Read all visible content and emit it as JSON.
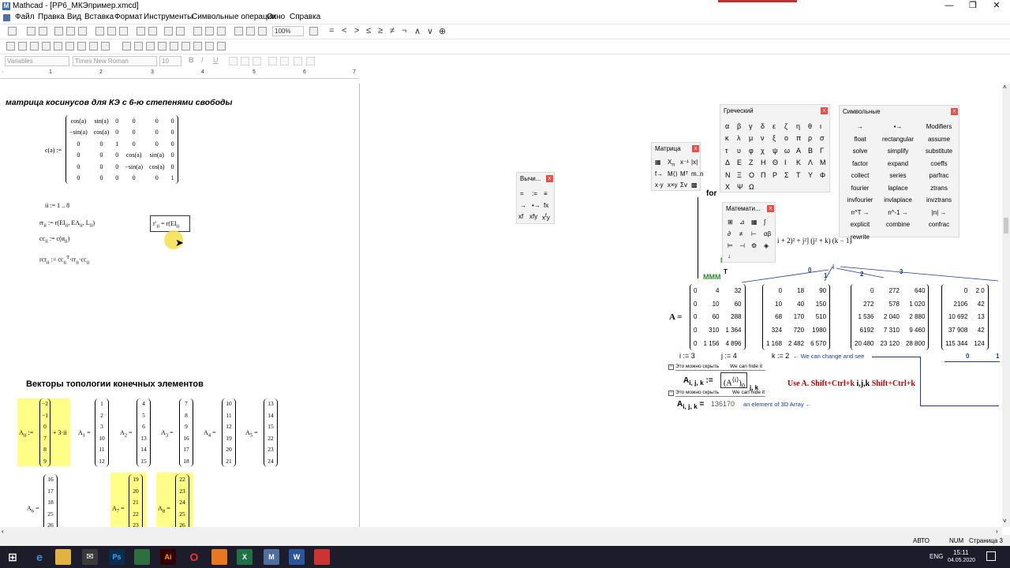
{
  "window": {
    "title": "Mathcad - [PP6_МКЭпример.xmcd]",
    "minimize": "—",
    "restore": "❐",
    "close": "✕"
  },
  "menu": [
    "Файл",
    "Правка",
    "Вид",
    "Вставка",
    "Формат",
    "Инструменты",
    "Символьные операции",
    "Окно",
    "Справка"
  ],
  "toolbar": {
    "zoom": "100%",
    "style": "Variables",
    "font": "Times New Roman",
    "size": "10",
    "bold": "B",
    "italic": "I",
    "underline": "U"
  },
  "ruler": [
    "1",
    "2",
    "3",
    "4",
    "5",
    "6",
    "7"
  ],
  "doc": {
    "heading1": "матрица косинусов для КЭ с 6-ю степенями свободы",
    "c_lhs": "c(a) :=",
    "c_matrix": [
      [
        "cos(a)",
        "sin(a)",
        "0",
        "0",
        "0",
        "0"
      ],
      [
        "−sin(a)",
        "cos(a)",
        "0",
        "0",
        "0",
        "0"
      ],
      [
        "0",
        "0",
        "1",
        "0",
        "0",
        "0"
      ],
      [
        "0",
        "0",
        "0",
        "cos(a)",
        "sin(a)",
        "0"
      ],
      [
        "0",
        "0",
        "0",
        "−sin(a)",
        "cos(a)",
        "0"
      ],
      [
        "0",
        "0",
        "0",
        "0",
        "0",
        "1"
      ]
    ],
    "ii_def": "ii := 1 .. 8",
    "rr_def": "rr<sub>ii</sub> := r(EI<sub>ii</sub>, EA<sub>ii</sub>, L<sub>ii</sub>)",
    "r_box": "r′<sub>ii</sub> = r(EI<sub>ii</sub>",
    "cc_def": "cc<sub>ii</sub> := c(α<sub>ii</sub>)",
    "rcr_def": "rcr<sub>ii</sub> := cc<sub>ii</sub><sup>T</sup>·rr<sub>ii</sub>·cc<sub>ii</sub>",
    "heading2": "Векторы топологии конечных элементов",
    "A_ii_lhs": "A<sub>ii</sub> :=",
    "A_ii_vec": [
      "−2",
      "−1",
      "0",
      "7",
      "8",
      "9"
    ],
    "A_ii_rhs": "+ 3·ii",
    "vectors": [
      {
        "label": "A<sub>1</sub> =",
        "values": [
          "1",
          "2",
          "3",
          "10",
          "11",
          "12"
        ]
      },
      {
        "label": "A<sub>2</sub> =",
        "values": [
          "4",
          "5",
          "6",
          "13",
          "14",
          "15"
        ]
      },
      {
        "label": "A<sub>3</sub> =",
        "values": [
          "7",
          "8",
          "9",
          "16",
          "17",
          "18"
        ]
      },
      {
        "label": "A<sub>4</sub> =",
        "values": [
          "10",
          "11",
          "12",
          "19",
          "20",
          "21"
        ]
      },
      {
        "label": "A<sub>5</sub> =",
        "values": [
          "13",
          "14",
          "15",
          "22",
          "23",
          "24"
        ]
      }
    ],
    "vectors_row2": [
      {
        "label": "A<sub>6</sub> =",
        "values": [
          "16",
          "17",
          "18",
          "25",
          "26"
        ]
      },
      {
        "label": "A<sub>7</sub> =",
        "values": [
          "19",
          "20",
          "21",
          "22",
          "23"
        ]
      },
      {
        "label": "A<sub>8</sub> =",
        "values": [
          "22",
          "23",
          "24",
          "25",
          "26"
        ]
      }
    ]
  },
  "right": {
    "for": "for",
    "mmm": "MMM",
    "T": "T",
    "formula_frag": "i + 2)² + j²] (j² + k) (k − 1)",
    "A_eq": "A =",
    "idx_top": [
      "0",
      "1",
      "2",
      "3"
    ],
    "idx_i": "i",
    "blocks": [
      [
        [
          "0",
          "4",
          "32"
        ],
        [
          "0",
          "10",
          "60"
        ],
        [
          "0",
          "60",
          "288"
        ],
        [
          "0",
          "310",
          "1 364"
        ],
        [
          "0",
          "1 156",
          "4 896"
        ]
      ],
      [
        [
          "0",
          "18",
          "90"
        ],
        [
          "10",
          "40",
          "150"
        ],
        [
          "68",
          "170",
          "510"
        ],
        [
          "324",
          "720",
          "1980"
        ],
        [
          "1 168",
          "2 482",
          "6 570"
        ]
      ],
      [
        [
          "0",
          "272",
          "640"
        ],
        [
          "272",
          "578",
          "1 020"
        ],
        [
          "1 536",
          "2 040",
          "2 880"
        ],
        [
          "6192",
          "7 310",
          "9 460"
        ],
        [
          "20 480",
          "23 120",
          "28 800"
        ]
      ],
      [
        [
          "0",
          "2 0"
        ],
        [
          "2106",
          "42"
        ],
        [
          "10 692",
          "13"
        ],
        [
          "37 908",
          "42"
        ],
        [
          "115 344",
          "124"
        ]
      ]
    ],
    "i_def": "i := 3",
    "j_def": "j := 4",
    "k_def": "k := 2",
    "k_note": "← We can change and see",
    "bottom_idx": [
      "0",
      "1"
    ],
    "hide1": "Это можно скрыть",
    "hide1b": "We can hide it",
    "hide2": "Это можно скрыть",
    "hide2b": "We can hide it",
    "A_ijk_def": "A<sub>i, j, k</sub> :=",
    "A_ijk_box": "(A<sup>⟨i⟩</sup>)<sub>0</sub>",
    "A_ijk_sub": "j, k",
    "use_text": "Use A. ",
    "use_red": "Shift+Ctrl+k",
    "use_mid": " i,j,k ",
    "use_red2": "Shift+Ctrl+k",
    "A_ijk_val": "A<sub>i, j, k</sub> =",
    "value": "136170",
    "val_note": "an element of  3D Array ←"
  },
  "panels": {
    "greek": {
      "title": "Греческий",
      "chars": [
        "α",
        "β",
        "γ",
        "δ",
        "ε",
        "ζ",
        "η",
        "θ",
        "ι",
        "κ",
        "λ",
        "μ",
        "ν",
        "ξ",
        "ο",
        "π",
        "ρ",
        "σ",
        "τ",
        "υ",
        "φ",
        "χ",
        "ψ",
        "ω",
        "Α",
        "Β",
        "Γ",
        "Δ",
        "Ε",
        "Ζ",
        "Η",
        "Θ",
        "Ι",
        "Κ",
        "Λ",
        "Μ",
        "Ν",
        "Ξ",
        "Ο",
        "Π",
        "Ρ",
        "Σ",
        "Τ",
        "Υ",
        "Φ",
        "Χ",
        "Ψ",
        "Ω"
      ]
    },
    "symbolic": {
      "title": "Символьные",
      "items": [
        "→",
        "•→",
        "Modifiers",
        "float",
        "rectangular",
        "assume",
        "solve",
        "simplify",
        "substitute",
        "factor",
        "expand",
        "coeffs",
        "collect",
        "series",
        "parfrac",
        "fourier",
        "laplace",
        "ztrans",
        "invfourier",
        "invlaplace",
        "invztrans",
        "n^T →",
        "n^-1 →",
        "|n| →",
        "explicit",
        "combine",
        "confrac",
        "rewrite"
      ]
    },
    "matrix": {
      "title": "Матрица"
    },
    "calc": {
      "title": "Вычи..."
    },
    "math": {
      "title": "Математи..."
    }
  },
  "status": {
    "auto": "АВТО",
    "num": "NUM",
    "page": "Страница 3"
  },
  "taskbar": {
    "lang": "ENG",
    "time": "15:11",
    "date": "04.05.2020"
  }
}
